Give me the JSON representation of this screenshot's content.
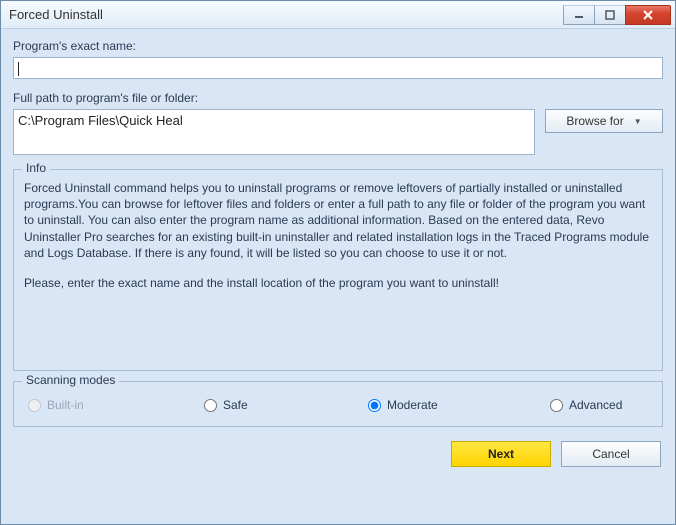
{
  "window": {
    "title": "Forced Uninstall"
  },
  "labels": {
    "program_name": "Program's exact name:",
    "full_path": "Full path to program's file or folder:",
    "browse": "Browse for",
    "info_legend": "Info",
    "modes_legend": "Scanning modes"
  },
  "values": {
    "program_name": "",
    "full_path": "C:\\Program Files\\Quick Heal"
  },
  "info": {
    "paragraph1": "Forced Uninstall command helps you to uninstall programs or remove leftovers of partially installed or uninstalled programs.You can browse for leftover files and folders or enter a full path to any file or folder of the program you want to uninstall. You can also enter the program name as additional information. Based on the entered data, Revo Uninstaller Pro searches for an existing built-in uninstaller and related installation logs in the Traced Programs module and Logs Database. If there is any found, it will be listed so you can choose to use it or not.",
    "paragraph2": "Please, enter the exact name and the install location of the program you want to uninstall!"
  },
  "scanning_modes": {
    "builtin": "Built-in",
    "safe": "Safe",
    "moderate": "Moderate",
    "advanced": "Advanced",
    "selected": "moderate"
  },
  "footer": {
    "next": "Next",
    "cancel": "Cancel"
  }
}
